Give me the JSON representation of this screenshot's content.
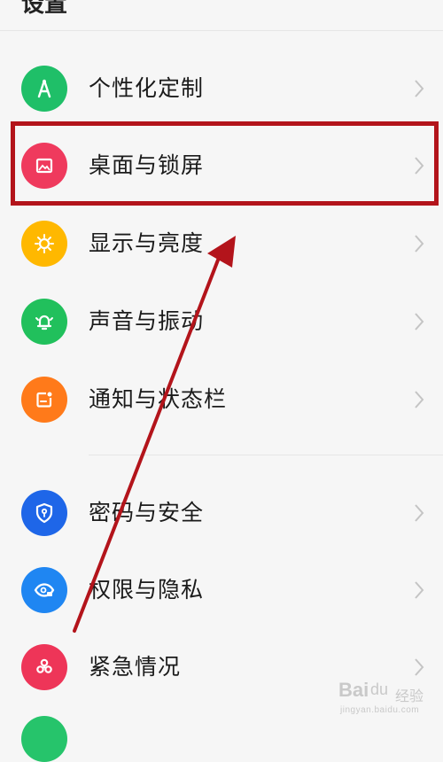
{
  "header": {
    "title": "设置"
  },
  "colors": {
    "personalize": "#1fbf68",
    "desktop": "#ef3a5d",
    "display": "#ffb800",
    "sound": "#21c05c",
    "notification": "#ff7a1a",
    "password": "#1e66e8",
    "permission": "#1f86f2",
    "emergency": "#ee3558",
    "highlight": "#b3141b"
  },
  "items": [
    {
      "label": "个性化定制",
      "icon": "personalize-icon"
    },
    {
      "label": "桌面与锁屏",
      "icon": "image-icon"
    },
    {
      "label": "显示与亮度",
      "icon": "sun-icon"
    },
    {
      "label": "声音与振动",
      "icon": "bell-icon"
    },
    {
      "label": "通知与状态栏",
      "icon": "notification-icon"
    },
    {
      "label": "密码与安全",
      "icon": "shield-icon"
    },
    {
      "label": "权限与隐私",
      "icon": "eye-lock-icon"
    },
    {
      "label": "紧急情况",
      "icon": "asterisk-icon"
    }
  ],
  "watermark": {
    "main": "Bai",
    "paw": "du",
    "sub": "经验",
    "url": "jingyan.baidu.com"
  }
}
